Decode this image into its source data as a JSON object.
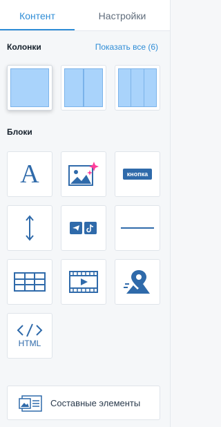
{
  "tabs": {
    "content": "Контент",
    "settings": "Настройки"
  },
  "columns": {
    "title": "Колонки",
    "show_all": "Показать все (6)"
  },
  "blocks": {
    "title": "Блоки",
    "button_label": "кнопка",
    "html_label": "HTML"
  },
  "composite": {
    "label": "Составные элементы"
  },
  "colors": {
    "accent": "#2e8cd6",
    "icon": "#2f6aaa",
    "column_fill": "#a9d3fb"
  }
}
